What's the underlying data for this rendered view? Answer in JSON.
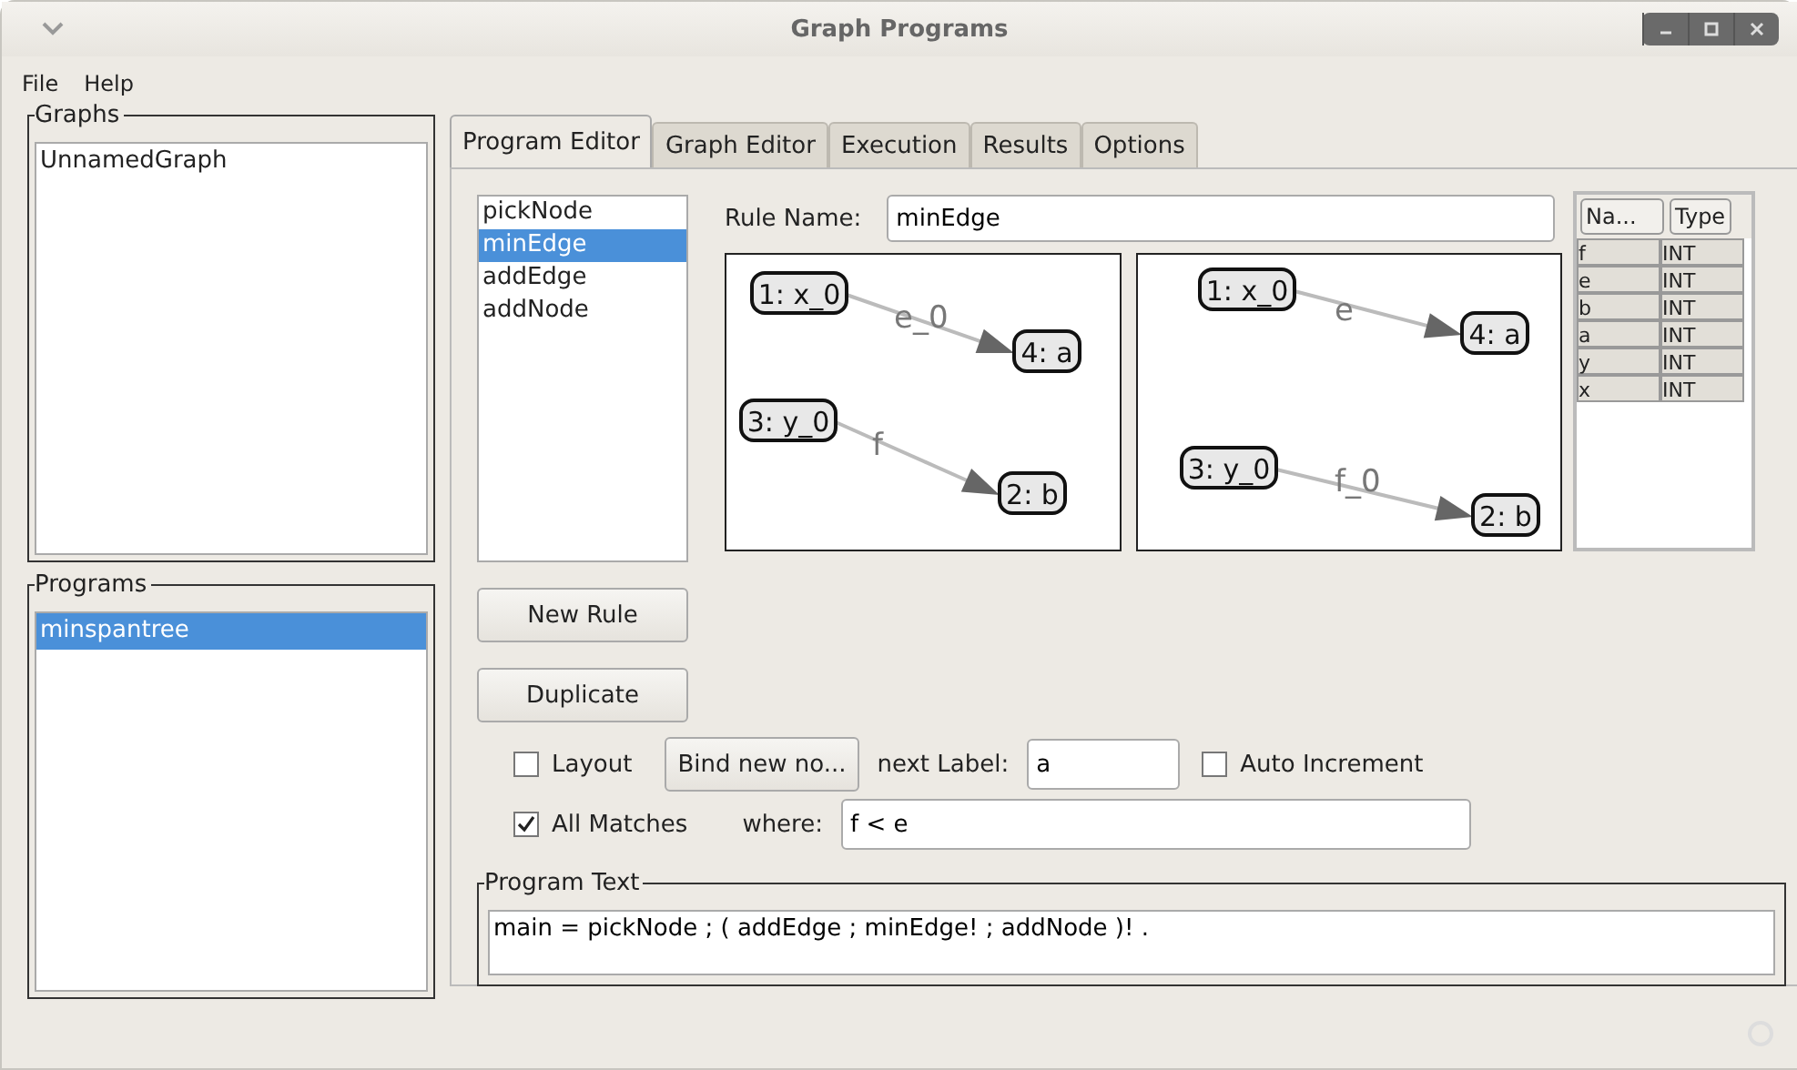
{
  "window": {
    "title": "Graph Programs"
  },
  "menu": [
    "File",
    "Help"
  ],
  "graphs": {
    "title": "Graphs",
    "items": [
      {
        "label": "UnnamedGraph",
        "selected": false
      }
    ]
  },
  "programs": {
    "title": "Programs",
    "items": [
      {
        "label": "minspantree",
        "selected": true
      }
    ]
  },
  "tabs": [
    {
      "label": "Program Editor",
      "selected": true
    },
    {
      "label": "Graph Editor",
      "selected": false
    },
    {
      "label": "Execution",
      "selected": false
    },
    {
      "label": "Results",
      "selected": false
    },
    {
      "label": "Options",
      "selected": false
    }
  ],
  "rules": [
    {
      "label": "pickNode",
      "selected": false
    },
    {
      "label": "minEdge",
      "selected": true
    },
    {
      "label": "addEdge",
      "selected": false
    },
    {
      "label": "addNode",
      "selected": false
    }
  ],
  "rule_buttons": [
    "New Rule",
    "Duplicate"
  ],
  "rule_name": {
    "label": "Rule Name:",
    "value": "minEdge"
  },
  "graphs_lr": [
    {
      "edges": [
        {
          "label": "e_0",
          "from": {
            "label": "1: x_0"
          },
          "to": {
            "label": "4: a"
          }
        },
        {
          "label": "f",
          "from": {
            "label": "3: y_0"
          },
          "to": {
            "label": "2: b"
          }
        }
      ]
    },
    {
      "edges": [
        {
          "label": "e",
          "from": {
            "label": "1: x_0"
          },
          "to": {
            "label": "4: a"
          }
        },
        {
          "label": "f_0",
          "from": {
            "label": "3: y_0"
          },
          "to": {
            "label": "2: b"
          }
        }
      ]
    }
  ],
  "variables": {
    "columns": [
      "Na...",
      "Type"
    ],
    "rows": [
      [
        "f",
        "INT"
      ],
      [
        "e",
        "INT"
      ],
      [
        "b",
        "INT"
      ],
      [
        "a",
        "INT"
      ],
      [
        "y",
        "INT"
      ],
      [
        "x",
        "INT"
      ]
    ]
  },
  "layout_check": {
    "label": "Layout",
    "checked": false
  },
  "bind_button": "Bind new no...",
  "next_label": {
    "label": "next Label:",
    "value": "a"
  },
  "auto_increment": {
    "label": "Auto Increment",
    "checked": false
  },
  "all_matches": {
    "label": "All Matches",
    "checked": true
  },
  "where": {
    "label": "where:",
    "value": "f < e"
  },
  "program_text": {
    "title": "Program Text",
    "value": "main = pickNode ; ( addEdge ; minEdge! ; addNode )! ."
  }
}
